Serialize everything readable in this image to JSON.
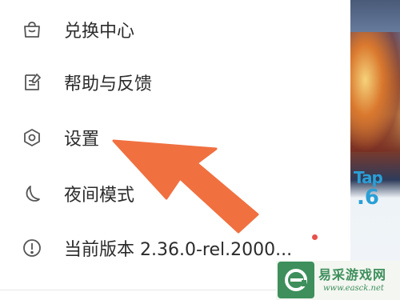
{
  "menu": {
    "items": [
      {
        "label": "兑换中心",
        "icon": "shopping-bag-icon"
      },
      {
        "label": "帮助与反馈",
        "icon": "edit-note-icon"
      },
      {
        "label": "设置",
        "icon": "hexagon-settings-icon"
      },
      {
        "label": "夜间模式",
        "icon": "moon-icon"
      },
      {
        "label": "当前版本 2.36.0-rel.2000...",
        "icon": "info-circle-icon"
      }
    ]
  },
  "background_app": {
    "game_name": "Tap",
    "game_number": ".6"
  },
  "watermark": {
    "chinese": "易采游戏网",
    "url": "www.easck.net"
  },
  "colors": {
    "arrow": "#f07040",
    "badge_dot": "#e8504a",
    "watermark": "#3e8f5c"
  }
}
